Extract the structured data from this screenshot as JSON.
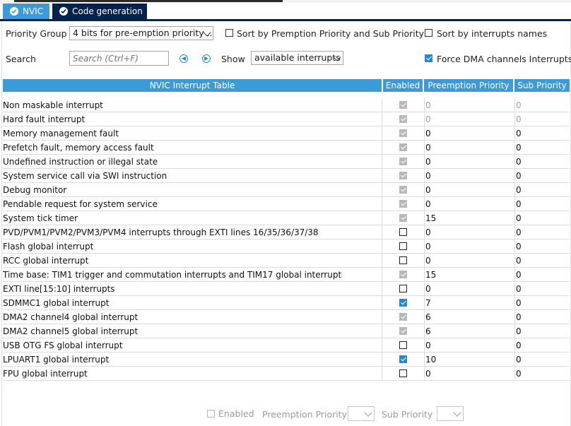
{
  "tabs": [
    {
      "label": "NVIC",
      "active": true
    },
    {
      "label": "Code generation",
      "active": false
    }
  ],
  "toolbar": {
    "priority_group_label": "Priority Group",
    "priority_group_value": "4 bits for pre-emption priority ...",
    "sort_premption_label": "Sort by Premption Priority and Sub Priority",
    "sort_premption_checked": false,
    "sort_names_label": "Sort by interrupts names",
    "sort_names_checked": false,
    "search_label": "Search",
    "search_placeholder": "Search (Ctrl+F)",
    "show_label": "Show",
    "show_value": "available interrupts",
    "force_dma_label": "Force DMA channels Interrupts",
    "force_dma_checked": true
  },
  "table": {
    "headers": {
      "name": "NVIC Interrupt Table",
      "enabled": "Enabled",
      "preemption": "Preemption Priority",
      "sub": "Sub Priority"
    },
    "rows": [
      {
        "name": "Non maskable interrupt",
        "enabled": "locked",
        "preemption": "0",
        "sub": "0",
        "dim": true
      },
      {
        "name": "Hard fault interrupt",
        "enabled": "locked",
        "preemption": "0",
        "sub": "0",
        "dim": true
      },
      {
        "name": "Memory management fault",
        "enabled": "locked",
        "preemption": "0",
        "sub": "0",
        "dim": false
      },
      {
        "name": "Prefetch fault, memory access fault",
        "enabled": "locked",
        "preemption": "0",
        "sub": "0",
        "dim": false
      },
      {
        "name": "Undefined instruction or illegal state",
        "enabled": "locked",
        "preemption": "0",
        "sub": "0",
        "dim": false
      },
      {
        "name": "System service call via SWI instruction",
        "enabled": "locked",
        "preemption": "0",
        "sub": "0",
        "dim": false
      },
      {
        "name": "Debug monitor",
        "enabled": "locked",
        "preemption": "0",
        "sub": "0",
        "dim": false
      },
      {
        "name": "Pendable request for system service",
        "enabled": "locked",
        "preemption": "0",
        "sub": "0",
        "dim": false
      },
      {
        "name": "System tick timer",
        "enabled": "locked",
        "preemption": "15",
        "sub": "0",
        "dim": false
      },
      {
        "name": "PVD/PVM1/PVM2/PVM3/PVM4 interrupts through EXTI lines 16/35/36/37/38",
        "enabled": "unchecked",
        "preemption": "0",
        "sub": "0",
        "dim": false
      },
      {
        "name": "Flash global interrupt",
        "enabled": "unchecked",
        "preemption": "0",
        "sub": "0",
        "dim": false
      },
      {
        "name": "RCC global interrupt",
        "enabled": "unchecked",
        "preemption": "0",
        "sub": "0",
        "dim": false
      },
      {
        "name": "Time base: TIM1 trigger and commutation interrupts and TIM17 global interrupt",
        "enabled": "locked",
        "preemption": "15",
        "sub": "0",
        "dim": false
      },
      {
        "name": "EXTI line[15:10] interrupts",
        "enabled": "unchecked",
        "preemption": "0",
        "sub": "0",
        "dim": false
      },
      {
        "name": "SDMMC1 global interrupt",
        "enabled": "checked",
        "preemption": "7",
        "sub": "0",
        "dim": false
      },
      {
        "name": "DMA2 channel4 global interrupt",
        "enabled": "locked",
        "preemption": "6",
        "sub": "0",
        "dim": false
      },
      {
        "name": "DMA2 channel5 global interrupt",
        "enabled": "locked",
        "preemption": "6",
        "sub": "0",
        "dim": false
      },
      {
        "name": "USB OTG FS global interrupt",
        "enabled": "unchecked",
        "preemption": "0",
        "sub": "0",
        "dim": false
      },
      {
        "name": "LPUART1 global interrupt",
        "enabled": "checked",
        "preemption": "10",
        "sub": "0",
        "dim": false
      },
      {
        "name": "FPU global interrupt",
        "enabled": "unchecked",
        "preemption": "0",
        "sub": "0",
        "dim": false
      }
    ]
  },
  "bottom": {
    "enabled_label": "Enabled",
    "preemption_label": "Preemption Priority",
    "sub_label": "Sub Priority"
  },
  "colors": {
    "accent": "#3c9ad6",
    "tab_dark": "#03234b",
    "checkbox_blue": "#1f8ad8",
    "locked_grey": "#b8b8b8"
  }
}
